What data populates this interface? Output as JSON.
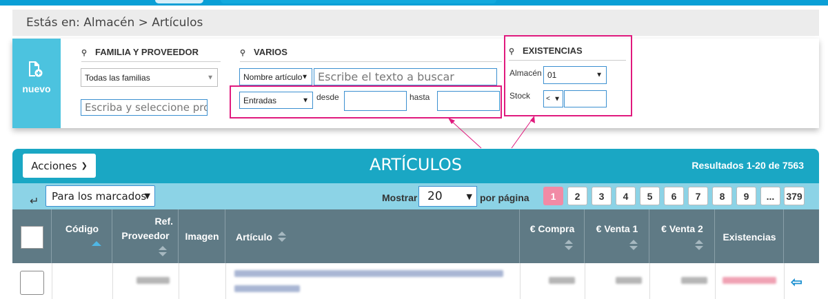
{
  "breadcrumb": {
    "text": "Estás en: Almacén > Artículos"
  },
  "new_button": {
    "label": "nuevo",
    "icon": "new-document-icon"
  },
  "filters": {
    "familia": {
      "title": "FAMILIA Y PROVEEDOR",
      "family_select": "Todas las familias",
      "provider_placeholder": "Escriba y seleccione prov"
    },
    "varios": {
      "title": "VARIOS",
      "field_select": "Nombre artículo",
      "search_placeholder": "Escribe el texto a buscar",
      "type_select": "Entradas",
      "desde_label": "desde",
      "hasta_label": "hasta",
      "desde_value": "",
      "hasta_value": ""
    },
    "existencias": {
      "title": "EXISTENCIAS",
      "almacen_label": "Almacén",
      "almacen_value": "01",
      "stock_label": "Stock",
      "stock_operator": "<",
      "stock_value": ""
    }
  },
  "table": {
    "actions_label": "Acciones",
    "title": "ARTÍCULOS",
    "results": "Resultados 1-20 de 7563",
    "marked_select": "Para los marcados",
    "show_label": "Mostrar",
    "per_page_value": "20",
    "per_page_label": "por página",
    "pages": [
      "1",
      "2",
      "3",
      "4",
      "5",
      "6",
      "7",
      "8",
      "9",
      "...",
      "379"
    ],
    "active_page": "1",
    "columns": {
      "codigo": "Código",
      "ref_prov_1": "Ref.",
      "ref_prov_2": "Proveedor",
      "imagen": "Imagen",
      "articulo": "Artículo",
      "compra": "€ Compra",
      "venta1": "€ Venta 1",
      "venta2": "€ Venta 2",
      "existencias": "Existencias"
    }
  },
  "colors": {
    "accent": "#1aa7c4",
    "toolbar": "#8cd3e6",
    "header_cols": "#5f7a85",
    "new_button": "#4cc3df",
    "highlight": "#e0197d",
    "active_page": "#f18aa5"
  }
}
